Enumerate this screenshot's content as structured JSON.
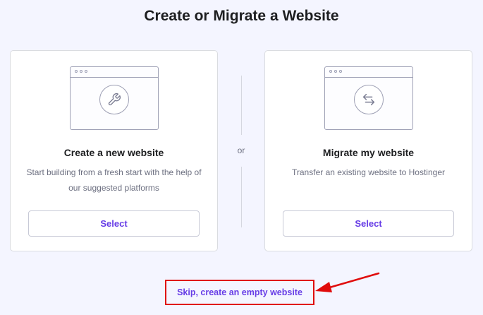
{
  "page": {
    "title": "Create or Migrate a Website"
  },
  "options": {
    "create": {
      "title": "Create a new website",
      "description": "Start building from a fresh start with the help of our suggested platforms",
      "button_label": "Select",
      "icon": "wrench-icon"
    },
    "migrate": {
      "title": "Migrate my website",
      "description": "Transfer an existing website to Hostinger",
      "button_label": "Select",
      "icon": "arrows-exchange-icon"
    },
    "separator_label": "or"
  },
  "skip": {
    "label": "Skip, create an empty website"
  },
  "colors": {
    "accent": "#673de6",
    "annotation": "#e00b0b",
    "background": "#f4f5ff"
  }
}
